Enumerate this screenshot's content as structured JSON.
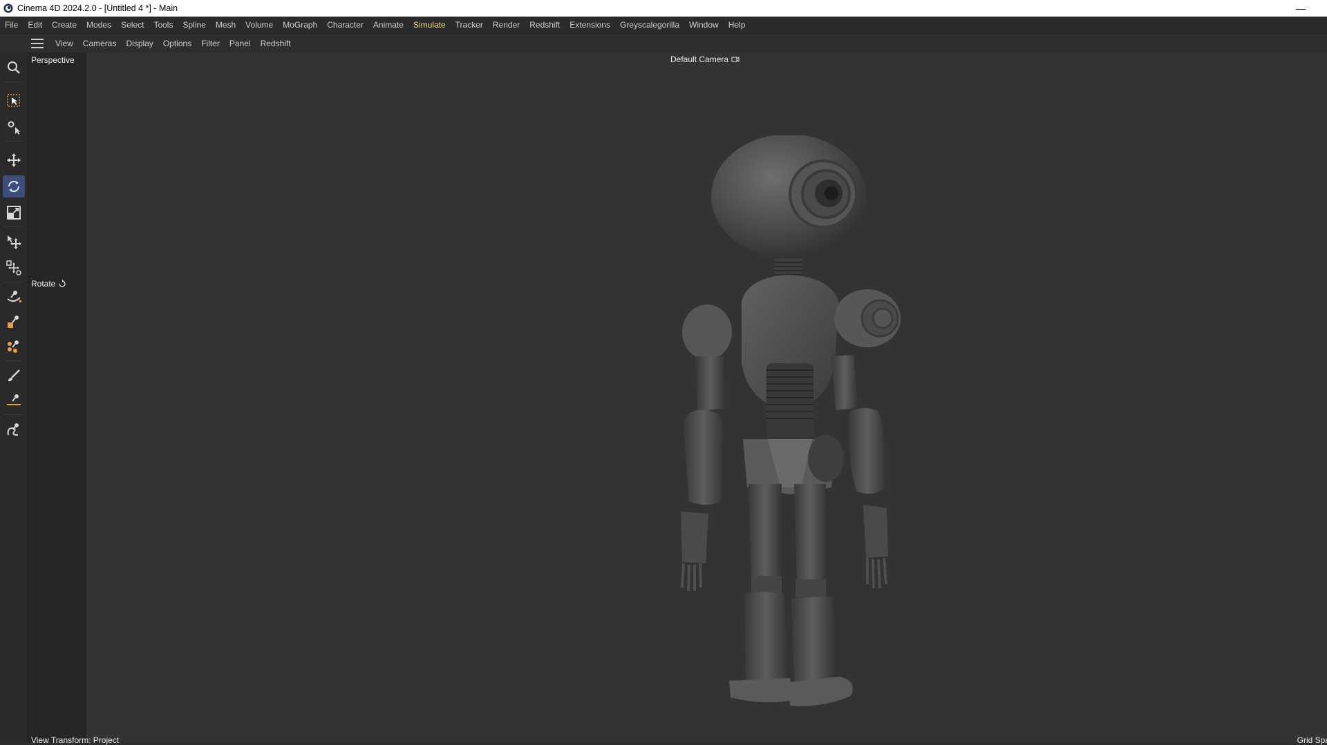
{
  "window": {
    "title": "Cinema 4D 2024.2.0 - [Untitled 4 *] - Main",
    "minimize_glyph": "—"
  },
  "menubar": {
    "items": [
      "File",
      "Edit",
      "Create",
      "Modes",
      "Select",
      "Tools",
      "Spline",
      "Mesh",
      "Volume",
      "MoGraph",
      "Character",
      "Animate",
      "Simulate",
      "Tracker",
      "Render",
      "Redshift",
      "Extensions",
      "Greyscalegorilla",
      "Window",
      "Help"
    ],
    "active": "Simulate"
  },
  "viewmenu": {
    "items": [
      "View",
      "Cameras",
      "Display",
      "Options",
      "Filter",
      "Panel",
      "Redshift"
    ]
  },
  "viewport": {
    "view_name": "Perspective",
    "camera": "Default Camera",
    "tool_hud": "Rotate",
    "bottom_left": "View Transform: Project",
    "bottom_right": "Grid Spa"
  },
  "toolbar": {
    "tools": [
      {
        "name": "search-icon"
      },
      {
        "name": "live-selection-icon"
      },
      {
        "name": "object-axis-icon"
      },
      {
        "name": "move-icon"
      },
      {
        "name": "rotate-icon",
        "active": true
      },
      {
        "name": "scale-icon"
      },
      {
        "name": "transfer-icon"
      },
      {
        "name": "multi-transform-icon"
      },
      {
        "name": "knife-curve-icon"
      },
      {
        "name": "polygon-pen-icon"
      },
      {
        "name": "material-paint-icon"
      },
      {
        "name": "brush-icon"
      },
      {
        "name": "line-cut-icon"
      },
      {
        "name": "spline-pen-icon"
      }
    ]
  },
  "colors": {
    "accent_active_menu": "#f0d98a",
    "active_tool_bg": "#3e4e7a",
    "viewport_bg": "#333333"
  }
}
